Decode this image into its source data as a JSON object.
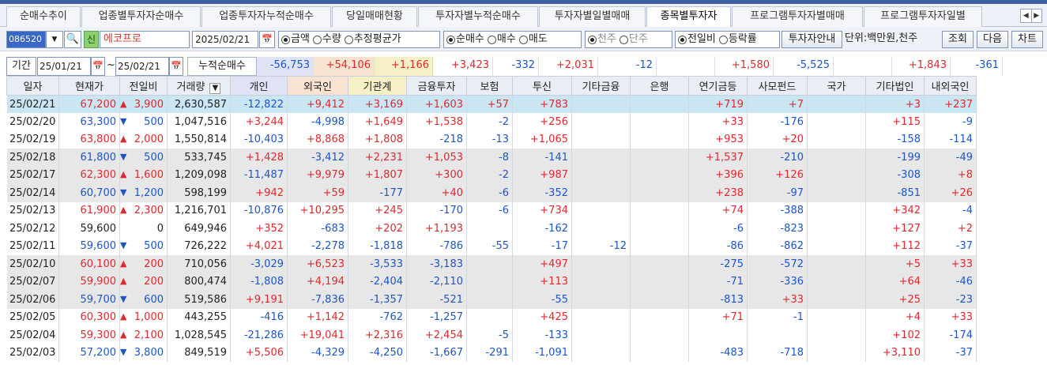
{
  "tabs": [
    {
      "label": "순매수추이",
      "active": false
    },
    {
      "label": "업종별투자자순매수",
      "active": false
    },
    {
      "label": "업종투자자누적순매수",
      "active": false
    },
    {
      "label": "당일매매현황",
      "active": false
    },
    {
      "label": "투자자별누적순매수",
      "active": false
    },
    {
      "label": "투자자별일별매매",
      "active": false
    },
    {
      "label": "종목별투자자",
      "active": true
    },
    {
      "label": "프로그램투자자별매매",
      "active": false
    },
    {
      "label": "프로그램투자자일별",
      "active": false
    }
  ],
  "toolbar": {
    "code": "086520",
    "shin_badge": "신",
    "stock_name": "에코프로",
    "date": "2025/02/21",
    "radio_group1": [
      {
        "label": "금액",
        "selected": true
      },
      {
        "label": "수량",
        "selected": false
      },
      {
        "label": "추정평균가",
        "selected": false
      }
    ],
    "radio_group2": [
      {
        "label": "순매수",
        "selected": true
      },
      {
        "label": "매수",
        "selected": false
      },
      {
        "label": "매도",
        "selected": false
      }
    ],
    "radio_group3": [
      {
        "label": "천주",
        "selected": true
      },
      {
        "label": "단주",
        "selected": false
      }
    ],
    "radio_group4": [
      {
        "label": "전일비",
        "selected": true
      },
      {
        "label": "등락률",
        "selected": false
      }
    ],
    "investor_guide": "투자자안내",
    "unit_label": "단위:백만원,천주",
    "query_button": "조회",
    "next_button": "다음",
    "chart_button": "차트"
  },
  "period": {
    "label": "기간",
    "from": "25/01/21",
    "to": "25/02/21",
    "separator": "~",
    "cumulative_label": "누적순매수",
    "sums": [
      "-56,753",
      "+54,106",
      "+1,166",
      "+3,423",
      "-332",
      "+2,031",
      "-12",
      "",
      "+1,580",
      "-5,525",
      "",
      "+1,843",
      "-361"
    ]
  },
  "columns": [
    "일자",
    "현재가",
    "전일비",
    "거래량",
    "개인",
    "외국인",
    "기관계",
    "금융투자",
    "보험",
    "투신",
    "기타금융",
    "은행",
    "연기금등",
    "사모펀드",
    "국가",
    "기타법인",
    "내외국인"
  ],
  "rows": [
    {
      "date": "25/02/21",
      "price": "67,200",
      "dir": "up",
      "change": "3,900",
      "volume": "2,630,587",
      "vals": [
        "-12,822",
        "+9,412",
        "+3,169",
        "+1,603",
        "+57",
        "+783",
        "",
        "",
        "+719",
        "+7",
        "",
        "+3",
        "+237"
      ]
    },
    {
      "date": "25/02/20",
      "price": "63,300",
      "dir": "down",
      "change": "500",
      "volume": "1,047,516",
      "vals": [
        "+3,244",
        "-4,998",
        "+1,649",
        "+1,538",
        "-2",
        "+256",
        "",
        "",
        "+33",
        "-176",
        "",
        "+115",
        "-9"
      ]
    },
    {
      "date": "25/02/19",
      "price": "63,800",
      "dir": "up",
      "change": "2,000",
      "volume": "1,550,814",
      "vals": [
        "-10,403",
        "+8,868",
        "+1,808",
        "-218",
        "-13",
        "+1,065",
        "",
        "",
        "+953",
        "+20",
        "",
        "-158",
        "-114"
      ]
    },
    {
      "date": "25/02/18",
      "price": "61,800",
      "dir": "down",
      "change": "500",
      "volume": "533,745",
      "vals": [
        "+1,428",
        "-3,412",
        "+2,231",
        "+1,053",
        "-8",
        "-141",
        "",
        "",
        "+1,537",
        "-210",
        "",
        "-199",
        "-49"
      ]
    },
    {
      "date": "25/02/17",
      "price": "62,300",
      "dir": "up",
      "change": "1,600",
      "volume": "1,209,098",
      "vals": [
        "-11,487",
        "+9,979",
        "+1,807",
        "+300",
        "-2",
        "+987",
        "",
        "",
        "+396",
        "+126",
        "",
        "-308",
        "+8"
      ]
    },
    {
      "date": "25/02/14",
      "price": "60,700",
      "dir": "down",
      "change": "1,200",
      "volume": "598,199",
      "vals": [
        "+942",
        "+59",
        "-177",
        "+40",
        "-6",
        "-352",
        "",
        "",
        "+238",
        "-97",
        "",
        "-851",
        "+26"
      ]
    },
    {
      "date": "25/02/13",
      "price": "61,900",
      "dir": "up",
      "change": "2,300",
      "volume": "1,216,701",
      "vals": [
        "-10,876",
        "+10,295",
        "+245",
        "-170",
        "-6",
        "+734",
        "",
        "",
        "+74",
        "-388",
        "",
        "+342",
        "-4"
      ]
    },
    {
      "date": "25/02/12",
      "price": "59,600",
      "dir": "none",
      "change": "0",
      "volume": "649,946",
      "vals": [
        "+352",
        "-683",
        "+202",
        "+1,193",
        "",
        "-162",
        "",
        "",
        "-6",
        "-823",
        "",
        "+127",
        "+2"
      ]
    },
    {
      "date": "25/02/11",
      "price": "59,600",
      "dir": "down",
      "change": "500",
      "volume": "726,222",
      "vals": [
        "+4,021",
        "-2,278",
        "-1,818",
        "-786",
        "-55",
        "-17",
        "-12",
        "",
        "-86",
        "-862",
        "",
        "+112",
        "-37"
      ]
    },
    {
      "date": "25/02/10",
      "price": "60,100",
      "dir": "up",
      "change": "200",
      "volume": "710,056",
      "vals": [
        "-3,029",
        "+6,523",
        "-3,533",
        "-3,183",
        "",
        "+497",
        "",
        "",
        "-275",
        "-572",
        "",
        "+5",
        "+33"
      ]
    },
    {
      "date": "25/02/07",
      "price": "59,900",
      "dir": "up",
      "change": "200",
      "volume": "800,474",
      "vals": [
        "-1,808",
        "+4,194",
        "-2,404",
        "-2,110",
        "",
        "+113",
        "",
        "",
        "-71",
        "-336",
        "",
        "+64",
        "-46"
      ]
    },
    {
      "date": "25/02/06",
      "price": "59,700",
      "dir": "down",
      "change": "600",
      "volume": "519,586",
      "vals": [
        "+9,191",
        "-7,836",
        "-1,357",
        "-521",
        "",
        "-55",
        "",
        "",
        "-813",
        "+33",
        "",
        "+25",
        "-23"
      ]
    },
    {
      "date": "25/02/05",
      "price": "60,300",
      "dir": "up",
      "change": "1,000",
      "volume": "443,255",
      "vals": [
        "-416",
        "+1,142",
        "-762",
        "-1,257",
        "",
        "+425",
        "",
        "",
        "+71",
        "-1",
        "",
        "+4",
        "+33"
      ]
    },
    {
      "date": "25/02/04",
      "price": "59,300",
      "dir": "up",
      "change": "2,100",
      "volume": "1,028,545",
      "vals": [
        "-21,286",
        "+19,041",
        "+2,316",
        "+2,454",
        "-5",
        "-133",
        "",
        "",
        "",
        "",
        "",
        "+102",
        "-174"
      ]
    },
    {
      "date": "25/02/03",
      "price": "57,200",
      "dir": "down",
      "change": "3,800",
      "volume": "849,519",
      "vals": [
        "+5,506",
        "-4,329",
        "-4,250",
        "-1,667",
        "-291",
        "-1,091",
        "",
        "",
        "-483",
        "-718",
        "",
        "+3,110",
        "-37"
      ]
    }
  ],
  "colors": {
    "positive": "#e0282f",
    "negative": "#1d55c7",
    "selected_row": "#c9e6f2",
    "gray_row": "#e7e7e7",
    "accent": "#3d5fa5"
  }
}
